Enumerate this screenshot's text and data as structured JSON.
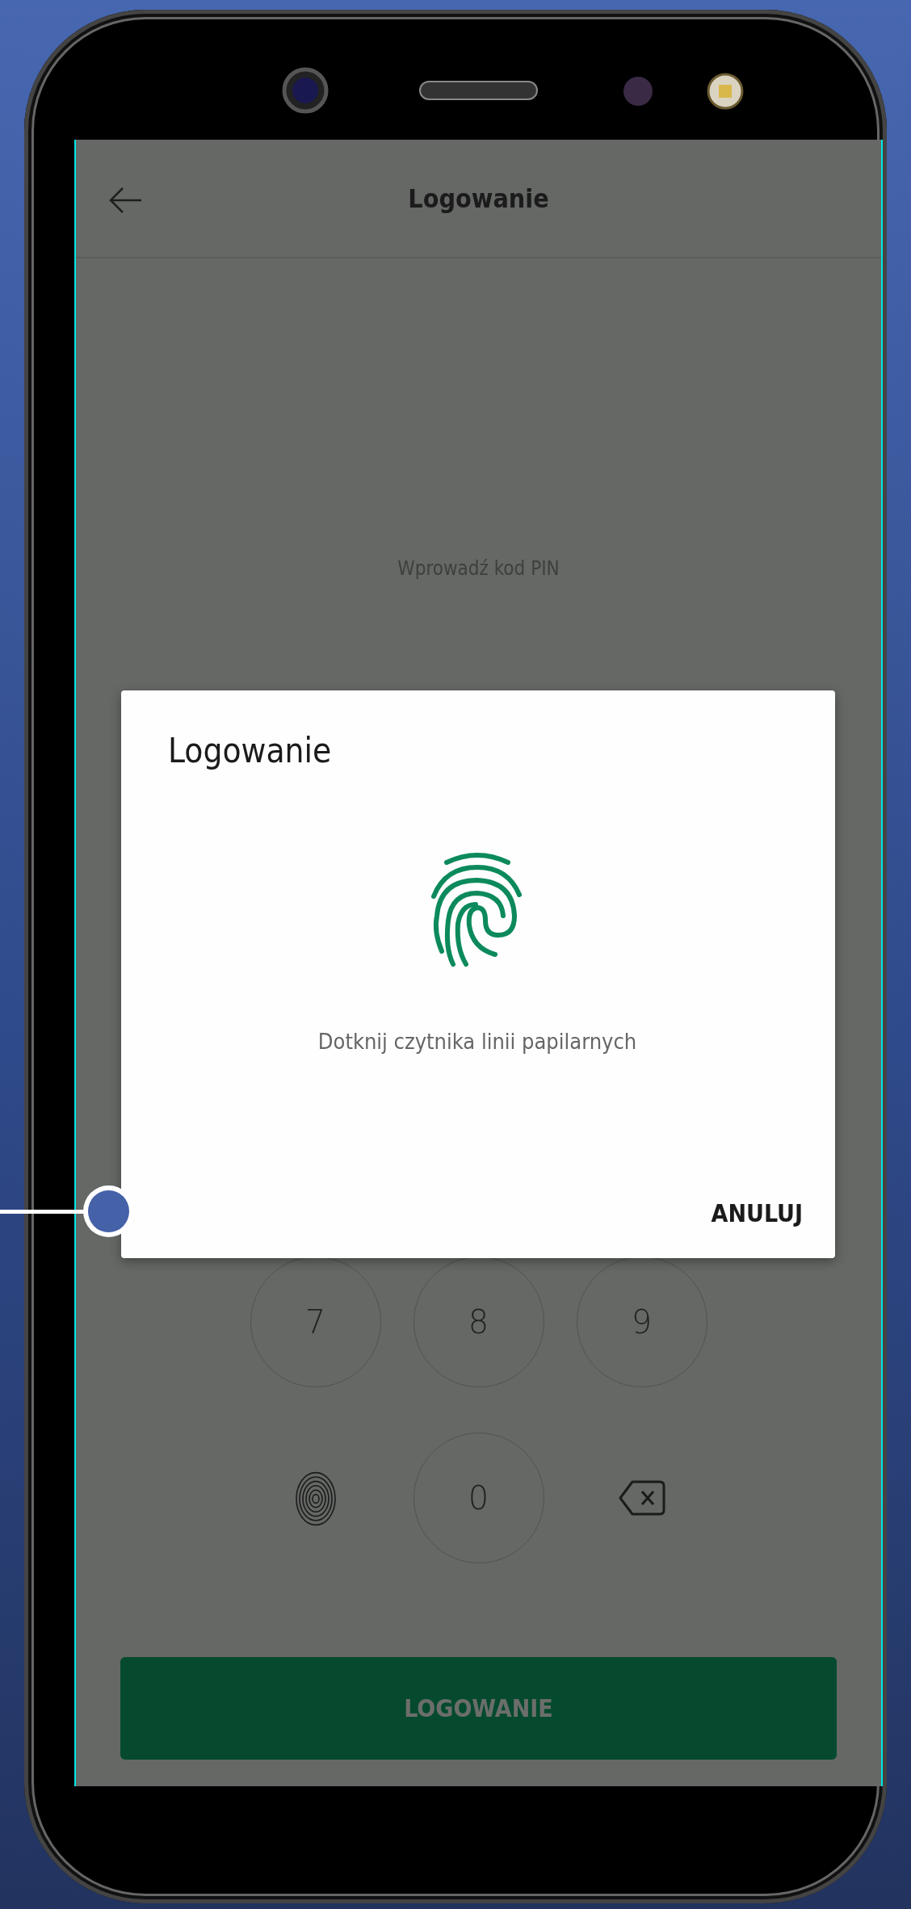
{
  "header": {
    "title": "Logowanie"
  },
  "pin_prompt": "Wprowadź kod PIN",
  "keypad": {
    "keys": [
      {
        "kind": "digit",
        "label": "7"
      },
      {
        "kind": "digit",
        "label": "8"
      },
      {
        "kind": "digit",
        "label": "9"
      },
      {
        "kind": "fingerprint"
      },
      {
        "kind": "digit",
        "label": "0"
      },
      {
        "kind": "backspace"
      }
    ]
  },
  "login_button": {
    "label": "LOGOWANIE",
    "disabled": true
  },
  "dialog": {
    "title": "Logowanie",
    "message": "Dotknij czytnika linii papilarnych",
    "cancel_button": "ANULUJ"
  }
}
